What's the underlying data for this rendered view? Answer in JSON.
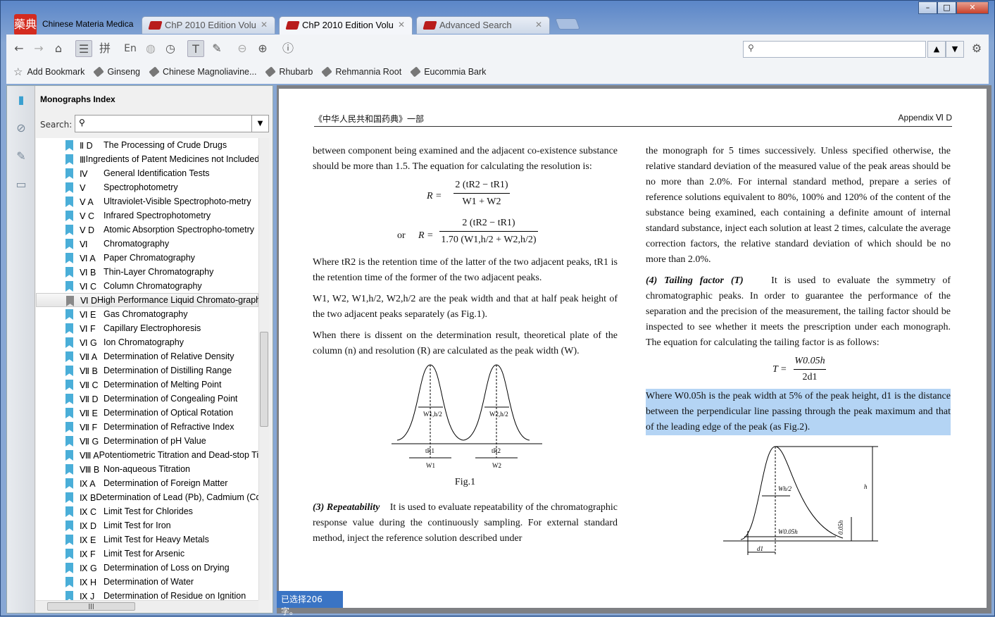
{
  "app": {
    "title": "Chinese Materia Medica",
    "logo_text": "藥典"
  },
  "tabs": [
    {
      "label": "ChP 2010 Edition Volu",
      "active": false
    },
    {
      "label": "ChP 2010 Edition Volu",
      "active": true
    },
    {
      "label": "Advanced Search",
      "active": false
    }
  ],
  "toolbar": {
    "icons": [
      "back-icon",
      "forward-icon",
      "home-icon",
      "list-icon",
      "pinyin-icon",
      "language-icon",
      "globe-icon",
      "history-icon",
      "text-select-icon",
      "highlight-icon",
      "zoom-out-icon",
      "zoom-in-icon",
      "info-icon"
    ],
    "pinyin": "拼",
    "lang": "En",
    "search_placeholder": ""
  },
  "bookmarks": {
    "add": "Add Bookmark",
    "items": [
      "Ginseng",
      "Chinese  Magnoliavine...",
      "Rhubarb",
      "Rehmannia Root",
      "Eucommia Bark"
    ]
  },
  "sidebar": {
    "title": "Monographs Index",
    "search_label": "Search:",
    "search_value": "",
    "items": [
      {
        "code": "Ⅱ D",
        "label": "The Processing of Crude Drugs"
      },
      {
        "code": "Ⅲ",
        "label": "Ingredients of Patent Medicines not Included"
      },
      {
        "code": "Ⅳ",
        "label": "General Identification Tests"
      },
      {
        "code": "Ⅴ",
        "label": "Spectrophotometry"
      },
      {
        "code": "Ⅴ A",
        "label": "Ultraviolet-Visible Spectrophoto-metry"
      },
      {
        "code": "Ⅴ C",
        "label": "Infrared Spectrophotometry"
      },
      {
        "code": "Ⅴ D",
        "label": "Atomic Absorption Spectropho-tometry"
      },
      {
        "code": "Ⅵ",
        "label": "Chromatography"
      },
      {
        "code": "Ⅵ A",
        "label": "Paper Chromatography"
      },
      {
        "code": "Ⅵ B",
        "label": "Thin-Layer Chromatography"
      },
      {
        "code": "Ⅵ C",
        "label": "Column Chromatography"
      },
      {
        "code": "Ⅵ D",
        "label": "High Performance Liquid Chromato-graphy",
        "selected": true
      },
      {
        "code": "Ⅵ E",
        "label": "Gas Chromatography"
      },
      {
        "code": "Ⅵ F",
        "label": "Capillary Electrophoresis"
      },
      {
        "code": "Ⅵ G",
        "label": "Ion Chromatography"
      },
      {
        "code": "Ⅶ A",
        "label": "Determination of Relative Density"
      },
      {
        "code": "Ⅶ B",
        "label": "Determination of Distilling Range"
      },
      {
        "code": "Ⅶ C",
        "label": "Determination of Melting Point"
      },
      {
        "code": "Ⅶ D",
        "label": "Determination of Congealing Point"
      },
      {
        "code": "Ⅶ E",
        "label": "Determination of Optical Rotation"
      },
      {
        "code": "Ⅶ F",
        "label": "Determination of Refractive Index"
      },
      {
        "code": "Ⅶ G",
        "label": "Determination of pH Value"
      },
      {
        "code": "Ⅷ A",
        "label": "Potentiometric Titration and Dead-stop Titration"
      },
      {
        "code": "Ⅷ B",
        "label": "Non-aqueous Titration"
      },
      {
        "code": "Ⅸ A",
        "label": "Determination of Foreign Matter"
      },
      {
        "code": "Ⅸ B",
        "label": "Determination of Lead (Pb), Cadmium (Cd)"
      },
      {
        "code": "Ⅸ C",
        "label": "Limit Test for Chlorides"
      },
      {
        "code": "Ⅸ D",
        "label": "Limit Test for Iron"
      },
      {
        "code": "Ⅸ E",
        "label": "Limit Test for Heavy Metals"
      },
      {
        "code": "Ⅸ F",
        "label": "Limit Test for Arsenic"
      },
      {
        "code": "Ⅸ G",
        "label": "Determination of Loss on Drying"
      },
      {
        "code": "Ⅸ H",
        "label": "Determination of Water"
      },
      {
        "code": "Ⅸ J",
        "label": "Determination of Residue on Ignition"
      }
    ]
  },
  "page": {
    "header_left": "《中华人民共和国药典》一部",
    "header_right": "Appendix Ⅵ D",
    "p1": "between component being examined and the adjacent co-existence substance should be more than 1.5. The equation for calculating the resolution is:",
    "eq1_num": "2 (tR2 − tR1)",
    "eq1_den": "W1 + W2",
    "eq_lhs": "R =",
    "eq_or": "or",
    "eq2_num": "2 (tR2 − tR1)",
    "eq2_den": "1.70 (W1,h/2 + W2,h/2)",
    "p2": "Where tR2 is the retention time of the latter of the two adjacent peaks, tR1 is the retention time of the former of the two adjacent peaks.",
    "p3": "W1, W2, W1,h/2, W2,h/2 are the peak width and that at half peak height of the two adjacent peaks separately (as Fig.1).",
    "p4": "When there is dissent on the determination result, theoretical plate of the column (n) and resolution (R) are calculated as the peak width (W).",
    "fig1_caption": "Fig.1",
    "fig1_labels": [
      "W1,h/2",
      "W2,h/2",
      "tR1",
      "tR2",
      "W1",
      "W2"
    ],
    "p5_head": "(3)  Repeatability",
    "p5": "It is used to evaluate repeatability of the chromatographic response value during the continuously sampling. For external standard method, inject the reference solution described under",
    "r1": "the monograph for 5 times successively. Unless specified otherwise, the relative standard deviation of the measured value of the peak areas should be no more than 2.0%. For internal standard method, prepare a series of reference solutions equivalent to 80%, 100% and 120% of the content of the substance being examined, each containing a definite amount of internal standard substance, inject each solution at least 2 times, calculate the average correction factors, the relative standard deviation of which should be no more than 2.0%.",
    "r2_head": "(4)  Tailing factor (T)",
    "r2": "It is used to evaluate the symmetry of chromatographic peaks. In order to guarantee the performance of the separation and the precision of the measurement, the tailing factor should be inspected to see whether it meets the prescription under each monograph. The equation for calculating the tailing factor is as follows:",
    "eq3_lhs": "T =",
    "eq3_num": "W0.05h",
    "eq3_den": "2d1",
    "r3": "Where W0.05h is the peak width at 5% of the peak height, d1 is the distance between the perpendicular line passing through the peak maximum and that of the leading edge of the peak (as Fig.2).",
    "fig2_labels": [
      "Wh/2",
      "W0.05h",
      "d1",
      "h",
      "0.05h"
    ]
  },
  "status": "已选择206字。",
  "colors": {
    "accent": "#3a74c4",
    "selection": "#b4d4f4",
    "bookmark": "#4aaed8"
  }
}
